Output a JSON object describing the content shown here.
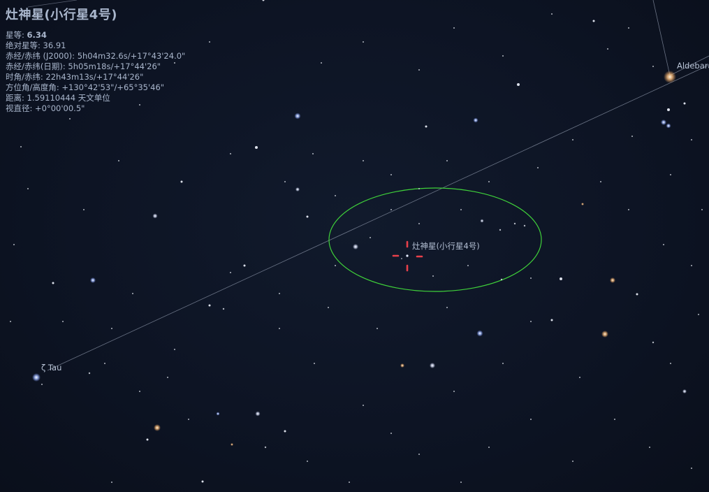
{
  "selected_object": {
    "title": "灶神星(小行星4号)",
    "info_rows": [
      {
        "label": "星等: ",
        "value": "6.34",
        "bold": true
      },
      {
        "label": "绝对星等: ",
        "value": "36.91"
      },
      {
        "label": "赤经/赤纬 (J2000): ",
        "value": "5h04m32.6s/+17°43'24.0\""
      },
      {
        "label": "赤经/赤纬(日期): ",
        "value": "5h05m18s/+17°44'26\""
      },
      {
        "label": "时角/赤纬: ",
        "value": "22h43m13s/+17°44'26\""
      },
      {
        "label": "方位角/高度角: ",
        "value": "+130°42'53\"/+65°35'46\""
      },
      {
        "label": "距离: ",
        "value": "1.59110444 天文单位"
      },
      {
        "label": "视直径: ",
        "value": "+0°00'00.5\""
      }
    ],
    "sky_label": "灶神星(小行星4号)"
  },
  "star_labels": {
    "aldebaran": "Aldebaran",
    "zeta_tau": "ζ Tau"
  },
  "colors": {
    "sky_background": "#0c1120",
    "hud_text": "#a9b6cc",
    "pointer_red": "#e8404a",
    "circle_green": "#3fd13a",
    "line_gray": "#8a93a6"
  },
  "icons": {
    "target_pointer": "crosshair-pointer-icon",
    "field_circle": "telescope-fov-circle"
  }
}
